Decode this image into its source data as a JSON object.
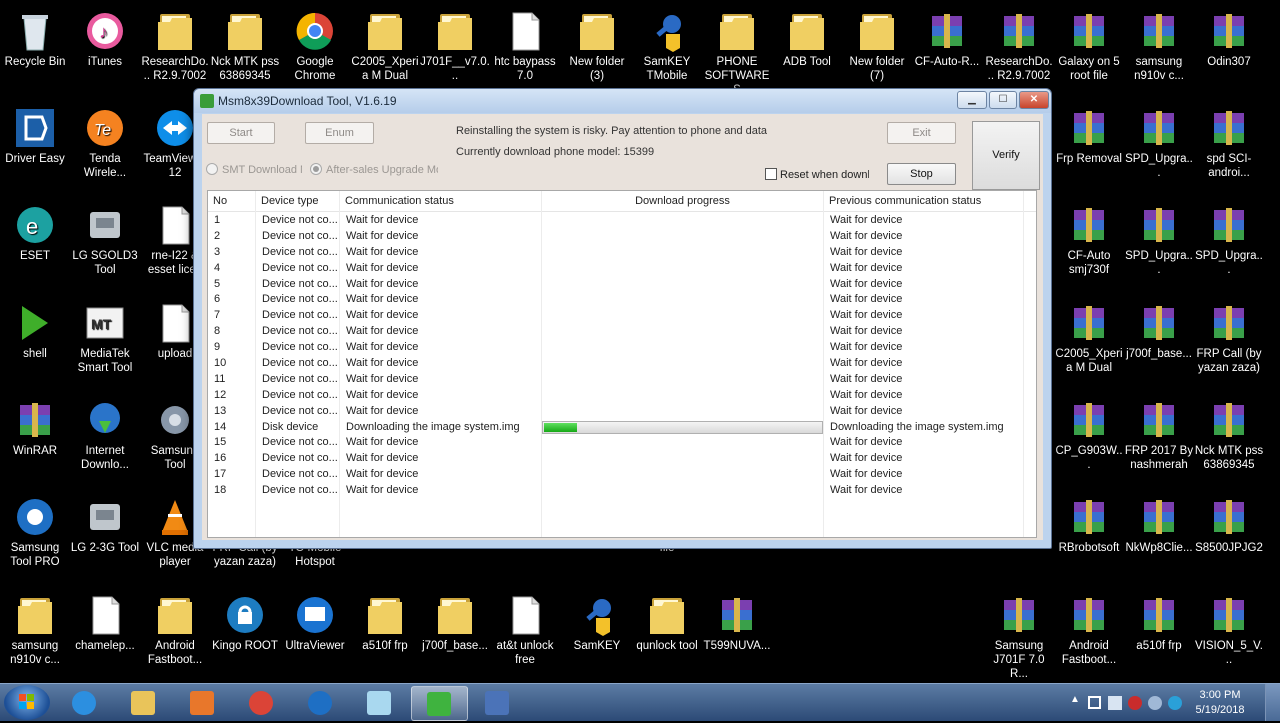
{
  "desktop": {
    "icons": [
      {
        "label": "Recycle Bin",
        "icon": "recycle-bin-icon"
      },
      {
        "label": "iTunes",
        "icon": "itunes-icon"
      },
      {
        "label": "ResearchDo... R2.9.7002",
        "icon": "folder-icon"
      },
      {
        "label": "Nck MTK pss 63869345",
        "icon": "folder-icon"
      },
      {
        "label": "Google Chrome",
        "icon": "chrome-icon"
      },
      {
        "label": "C2005_Xperia M Dual",
        "icon": "folder-icon"
      },
      {
        "label": "J701F__v7.0...",
        "icon": "folder-icon"
      },
      {
        "label": "htc baypass 7.0",
        "icon": "document-icon"
      },
      {
        "label": "New folder (3)",
        "icon": "folder-icon"
      },
      {
        "label": "SamKEY TMobile",
        "icon": "key-icon"
      },
      {
        "label": "PHONE SOFTWARES",
        "icon": "folder-icon"
      },
      {
        "label": "ADB Tool",
        "icon": "folder-icon"
      },
      {
        "label": "New folder (7)",
        "icon": "folder-icon"
      },
      {
        "label": "CF-Auto-R...",
        "icon": "winrar-icon"
      },
      {
        "label": "ResearchDo... R2.9.7002",
        "icon": "winrar-icon"
      },
      {
        "label": "Galaxy on 5 root file",
        "icon": "winrar-icon"
      },
      {
        "label": "samsung n910v c...",
        "icon": "winrar-icon"
      },
      {
        "label": "Odin307",
        "icon": "winrar-icon"
      },
      {
        "label": "Driver Easy",
        "icon": "driver-easy-icon"
      },
      {
        "label": "Tenda Wirele...",
        "icon": "tenda-icon"
      },
      {
        "label": "TeamViewer 12",
        "icon": "teamviewer-icon"
      },
      {
        "label": "Frp Removal",
        "icon": "winrar-icon"
      },
      {
        "label": "SPD_Upgra...",
        "icon": "winrar-icon"
      },
      {
        "label": "spd SCI-androi...",
        "icon": "winrar-icon"
      },
      {
        "label": "ESET",
        "icon": "eset-icon"
      },
      {
        "label": "LG SGOLD3 Tool",
        "icon": "tool-icon"
      },
      {
        "label": "rne-I22 & esset licen",
        "icon": "document-icon"
      },
      {
        "label": "CF-Auto smj730f",
        "icon": "winrar-icon"
      },
      {
        "label": "SPD_Upgra...",
        "icon": "winrar-icon"
      },
      {
        "label": "SPD_Upgra...",
        "icon": "winrar-icon"
      },
      {
        "label": "shell",
        "icon": "shell-icon"
      },
      {
        "label": "MediaTek Smart Tool",
        "icon": "mtk-icon"
      },
      {
        "label": "upload",
        "icon": "document-icon"
      },
      {
        "label": "C2005_Xperia M Dual",
        "icon": "winrar-icon"
      },
      {
        "label": "j700f_base...",
        "icon": "winrar-icon"
      },
      {
        "label": "FRP Call (by yazan zaza)",
        "icon": "winrar-icon"
      },
      {
        "label": "WinRAR",
        "icon": "winrar-icon"
      },
      {
        "label": "Internet Downlo...",
        "icon": "idm-icon"
      },
      {
        "label": "Samsung Tool",
        "icon": "gear-icon"
      },
      {
        "label": "CP_G903W...",
        "icon": "winrar-icon"
      },
      {
        "label": "FRP 2017 By nashmerah",
        "icon": "winrar-icon"
      },
      {
        "label": "Nck MTK pss 63869345",
        "icon": "winrar-icon"
      },
      {
        "label": "Samsung Tool PRO",
        "icon": "samsung-tool-icon"
      },
      {
        "label": "LG 2-3G Tool",
        "icon": "tool-icon"
      },
      {
        "label": "VLC media player",
        "icon": "vlc-icon"
      },
      {
        "label": "FRP Call (by yazan zaza)",
        "icon": "winrar-icon"
      },
      {
        "label": "TO Mobile Hotspot",
        "icon": "hotspot-icon"
      },
      {
        "label": "file",
        "icon": "document-icon"
      },
      {
        "label": "RBrobotsoft",
        "icon": "winrar-icon"
      },
      {
        "label": "NkWp8Clie...",
        "icon": "winrar-icon"
      },
      {
        "label": "S8500JPJG2",
        "icon": "winrar-icon"
      },
      {
        "label": "samsung n910v c...",
        "icon": "folder-icon"
      },
      {
        "label": "chamelep...",
        "icon": "document-icon"
      },
      {
        "label": "Android Fastboot...",
        "icon": "folder-icon"
      },
      {
        "label": "Kingo ROOT",
        "icon": "kingo-icon"
      },
      {
        "label": "UltraViewer",
        "icon": "ultraviewer-icon"
      },
      {
        "label": "a510f frp",
        "icon": "folder-icon"
      },
      {
        "label": "j700f_base...",
        "icon": "folder-icon"
      },
      {
        "label": "at&t unlock free",
        "icon": "document-icon"
      },
      {
        "label": "SamKEY",
        "icon": "key-icon"
      },
      {
        "label": "qunlock tool",
        "icon": "folder-icon"
      },
      {
        "label": "T599NUVA...",
        "icon": "winrar-icon"
      },
      {
        "label": "Samsung J701F 7.0 R...",
        "icon": "winrar-icon"
      },
      {
        "label": "Android Fastboot...",
        "icon": "winrar-icon"
      },
      {
        "label": "a510f frp",
        "icon": "winrar-icon"
      },
      {
        "label": "VISION_5_V...",
        "icon": "winrar-icon"
      }
    ]
  },
  "window": {
    "title": "Msm8x39Download Tool, V1.6.19",
    "controls": {
      "minimize": "▁",
      "maximize": "☐",
      "close": "✕"
    },
    "buttons": {
      "start": "Start",
      "enum": "Enum",
      "exit": "Exit",
      "stop": "Stop",
      "verify": "Verify"
    },
    "warning": "Reinstalling the system is risky. Pay attention to phone and data",
    "model": "Currently download phone model:  15399",
    "radio_smt": "SMT Download Mo",
    "radio_aftersales": "After-sales Upgrade Moc",
    "checkbox_reset": "Reset when downlo",
    "table": {
      "columns": [
        "No",
        "Device type",
        "Communication status",
        "Download progress",
        "Previous communication status"
      ],
      "rows": [
        {
          "no": "1",
          "type": "Device not co...",
          "status": "Wait for device",
          "progress": null,
          "prev": "Wait for device"
        },
        {
          "no": "2",
          "type": "Device not co...",
          "status": "Wait for device",
          "progress": null,
          "prev": "Wait for device"
        },
        {
          "no": "3",
          "type": "Device not co...",
          "status": "Wait for device",
          "progress": null,
          "prev": "Wait for device"
        },
        {
          "no": "4",
          "type": "Device not co...",
          "status": "Wait for device",
          "progress": null,
          "prev": "Wait for device"
        },
        {
          "no": "5",
          "type": "Device not co...",
          "status": "Wait for device",
          "progress": null,
          "prev": "Wait for device"
        },
        {
          "no": "6",
          "type": "Device not co...",
          "status": "Wait for device",
          "progress": null,
          "prev": "Wait for device"
        },
        {
          "no": "7",
          "type": "Device not co...",
          "status": "Wait for device",
          "progress": null,
          "prev": "Wait for device"
        },
        {
          "no": "8",
          "type": "Device not co...",
          "status": "Wait for device",
          "progress": null,
          "prev": "Wait for device"
        },
        {
          "no": "9",
          "type": "Device not co...",
          "status": "Wait for device",
          "progress": null,
          "prev": "Wait for device"
        },
        {
          "no": "10",
          "type": "Device not co...",
          "status": "Wait for device",
          "progress": null,
          "prev": "Wait for device"
        },
        {
          "no": "11",
          "type": "Device not co...",
          "status": "Wait for device",
          "progress": null,
          "prev": "Wait for device"
        },
        {
          "no": "12",
          "type": "Device not co...",
          "status": "Wait for device",
          "progress": null,
          "prev": "Wait for device"
        },
        {
          "no": "13",
          "type": "Device not co...",
          "status": "Wait for device",
          "progress": null,
          "prev": "Wait for device"
        },
        {
          "no": "14",
          "type": "Disk device",
          "status": "Downloading the image system.img",
          "progress": 0.12,
          "prev": "Downloading the image system.img"
        },
        {
          "no": "15",
          "type": "Device not co...",
          "status": "Wait for device",
          "progress": null,
          "prev": "Wait for device"
        },
        {
          "no": "16",
          "type": "Device not co...",
          "status": "Wait for device",
          "progress": null,
          "prev": "Wait for device"
        },
        {
          "no": "17",
          "type": "Device not co...",
          "status": "Wait for device",
          "progress": null,
          "prev": "Wait for device"
        },
        {
          "no": "18",
          "type": "Device not co...",
          "status": "Wait for device",
          "progress": null,
          "prev": "Wait for device"
        }
      ]
    }
  },
  "taskbar": {
    "items": [
      {
        "name": "ie-icon",
        "active": false
      },
      {
        "name": "explorer-icon",
        "active": false
      },
      {
        "name": "media-player-icon",
        "active": false
      },
      {
        "name": "chrome-icon",
        "active": false
      },
      {
        "name": "samsung-tool-icon",
        "active": false
      },
      {
        "name": "notepad-icon",
        "active": false
      },
      {
        "name": "download-tool-icon",
        "active": true
      },
      {
        "name": "network-tool-icon",
        "active": false
      }
    ],
    "time": "3:00 PM",
    "date": "5/19/2018"
  },
  "colors": {
    "progress_fill": "#16a816",
    "window_frame": "#bcd3ee",
    "client_bg": "#e9e2dc"
  }
}
